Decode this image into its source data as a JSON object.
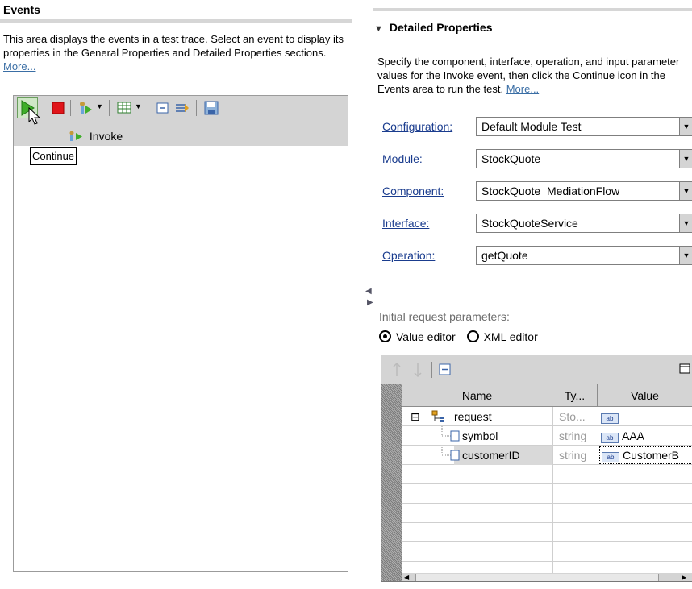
{
  "left": {
    "title": "Events",
    "description": "This area displays the events in a test trace. Select an event to display its properties in the General Properties and Detailed Properties sections.",
    "more_link": "More...",
    "tree_item": "Invoke",
    "tooltip": "Continue"
  },
  "right": {
    "section_title": "Detailed Properties",
    "description": "Specify the component, interface, operation, and input parameter values for the Invoke event, then click the Continue icon in the Events area to run the test.",
    "more_link": "More...",
    "fields": [
      {
        "label": "Configuration:",
        "value": "Default Module Test"
      },
      {
        "label": "Module:",
        "value": "StockQuote"
      },
      {
        "label": "Component:",
        "value": "StockQuote_MediationFlow"
      },
      {
        "label": "Interface:",
        "value": "StockQuoteService"
      },
      {
        "label": "Operation:",
        "value": "getQuote"
      }
    ],
    "initial_params_label": "Initial request parameters:",
    "radio_value_editor": "Value editor",
    "radio_xml_editor": "XML editor",
    "selected_editor": "Value editor",
    "table": {
      "headers": [
        "Name",
        "Ty...",
        "Value"
      ],
      "rows": [
        {
          "name": "request",
          "type": "Sto...",
          "value": ""
        },
        {
          "name": "symbol",
          "type": "string",
          "value": "AAA"
        },
        {
          "name": "customerID",
          "type": "string",
          "value": "CustomerB"
        }
      ]
    }
  },
  "icons": {
    "continue": "play-icon",
    "stop": "stop-icon",
    "step": "step-icon",
    "table": "table-icon",
    "collapse": "collapse-icon",
    "filter": "filter-icon",
    "save": "save-icon",
    "value_type": "ab-text-icon"
  }
}
